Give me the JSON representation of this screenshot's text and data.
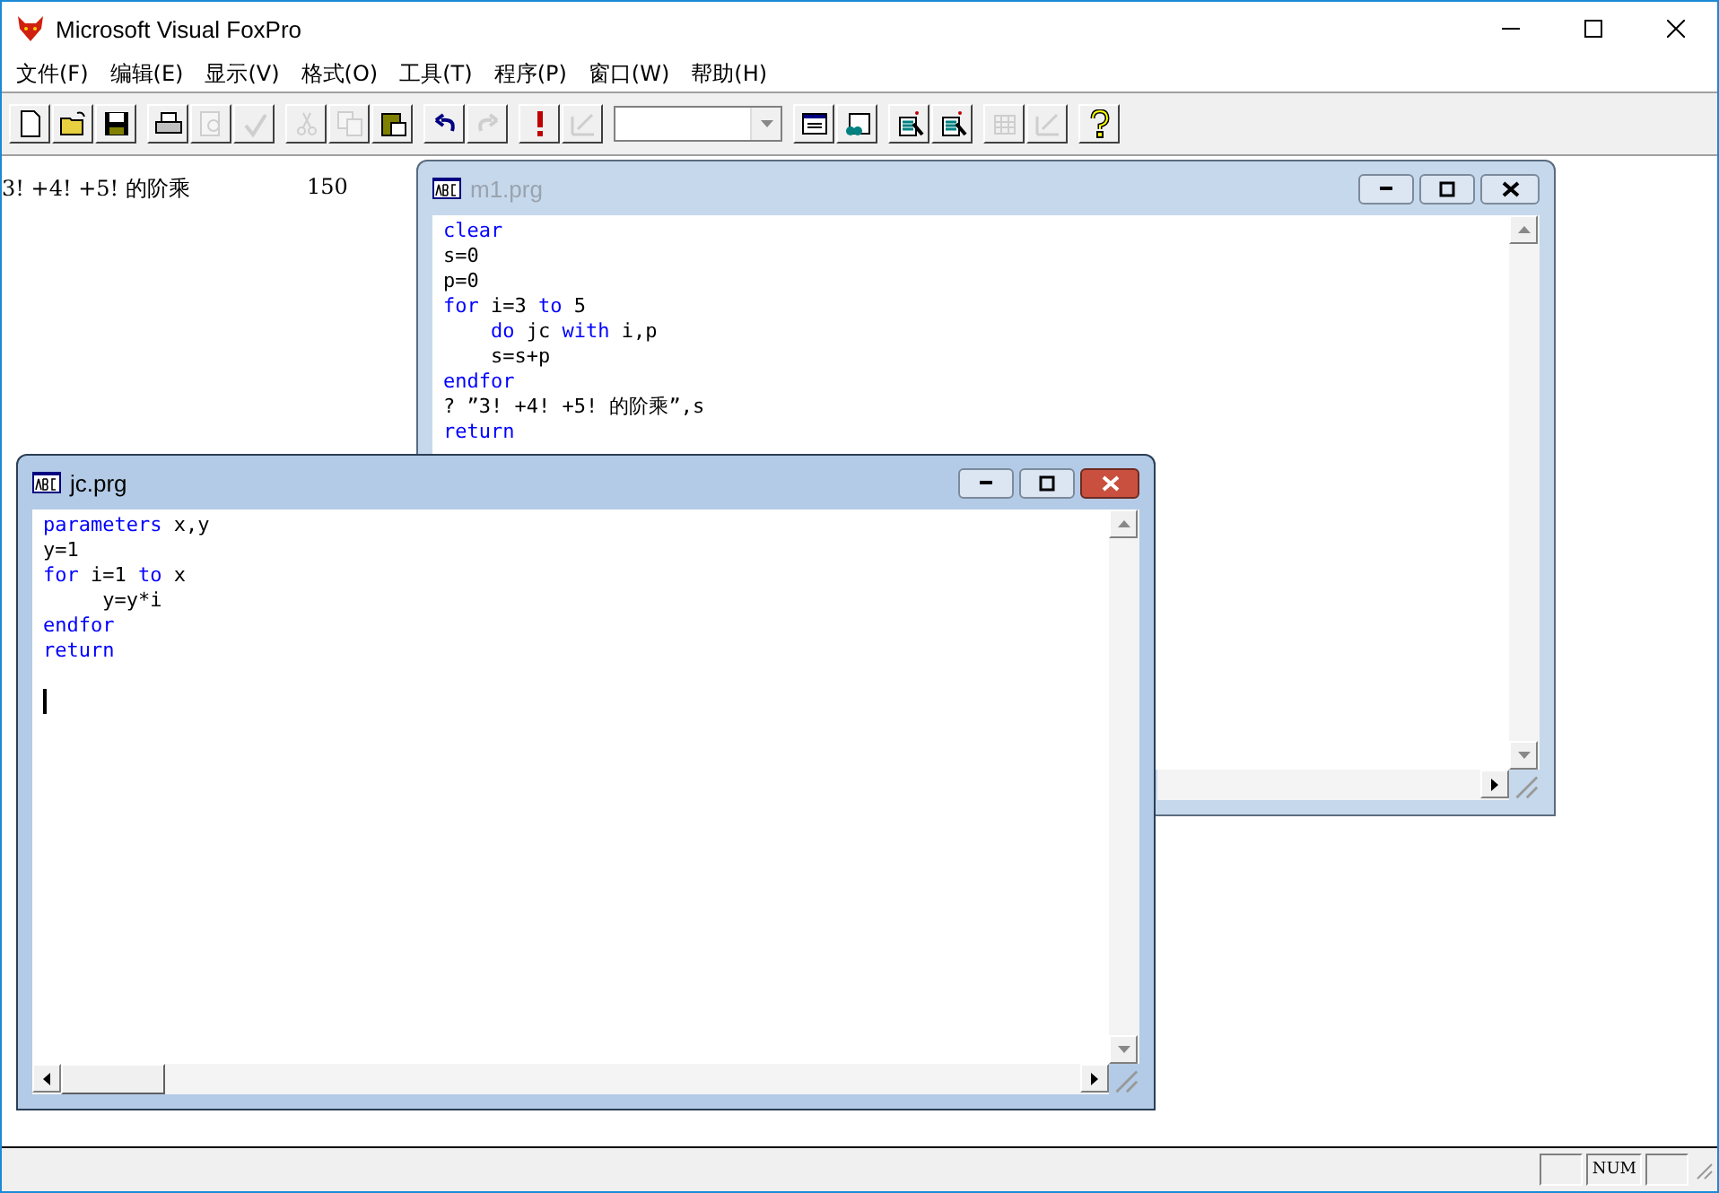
{
  "window": {
    "title": "Microsoft Visual FoxPro"
  },
  "menu": [
    {
      "label": "文件(F)"
    },
    {
      "label": "编辑(E)"
    },
    {
      "label": "显示(V)"
    },
    {
      "label": "格式(O)"
    },
    {
      "label": "工具(T)"
    },
    {
      "label": "程序(P)"
    },
    {
      "label": "窗口(W)"
    },
    {
      "label": "帮助(H)"
    }
  ],
  "toolbar": [
    [
      {
        "kind": "new",
        "disabled": false
      },
      {
        "kind": "open",
        "disabled": false
      },
      {
        "kind": "save",
        "disabled": false
      }
    ],
    [
      {
        "kind": "print",
        "disabled": false
      },
      {
        "kind": "preview",
        "disabled": true
      },
      {
        "kind": "spell",
        "disabled": true
      }
    ],
    [
      {
        "kind": "cut",
        "disabled": true
      },
      {
        "kind": "copy",
        "disabled": true
      },
      {
        "kind": "paste",
        "disabled": false
      }
    ],
    [
      {
        "kind": "undo",
        "disabled": false
      },
      {
        "kind": "redo",
        "disabled": true
      }
    ],
    [
      {
        "kind": "run",
        "disabled": false
      },
      {
        "kind": "modify",
        "disabled": true
      }
    ],
    [
      {
        "kind": "combo"
      }
    ],
    [
      {
        "kind": "form",
        "disabled": false
      },
      {
        "kind": "report",
        "disabled": false
      }
    ],
    [
      {
        "kind": "build",
        "disabled": false
      },
      {
        "kind": "build2",
        "disabled": false
      }
    ],
    [
      {
        "kind": "grid",
        "disabled": true
      },
      {
        "kind": "edit",
        "disabled": true
      }
    ],
    [
      {
        "kind": "help",
        "disabled": false
      }
    ]
  ],
  "output": [
    {
      "label": "3! +4! +5! 的阶乘",
      "value": "150"
    }
  ],
  "windows": [
    {
      "title": "m1.prg",
      "active": false,
      "lines": [
        [
          {
            "text": "clear",
            "keyword": true
          }
        ],
        [
          {
            "text": "s=0",
            "keyword": false
          }
        ],
        [
          {
            "text": "p=0",
            "keyword": false
          }
        ],
        [
          {
            "text": "for",
            "keyword": true
          },
          {
            "text": " i=3 ",
            "keyword": false
          },
          {
            "text": "to",
            "keyword": true
          },
          {
            "text": " 5",
            "keyword": false
          }
        ],
        [
          {
            "text": "    do",
            "keyword": true
          },
          {
            "text": " jc ",
            "keyword": false
          },
          {
            "text": "with",
            "keyword": true
          },
          {
            "text": " i,p",
            "keyword": false
          }
        ],
        [
          {
            "text": "    s=s+p",
            "keyword": false
          }
        ],
        [
          {
            "text": "endfor",
            "keyword": true
          }
        ],
        [
          {
            "text": "? ”3! +4! +5! 的阶乘”,s",
            "keyword": false
          }
        ],
        [
          {
            "text": "return",
            "keyword": true
          }
        ]
      ]
    },
    {
      "title": "jc.prg",
      "active": true,
      "cursor": true,
      "lines": [
        [
          {
            "text": "parameters",
            "keyword": true
          },
          {
            "text": " x,y",
            "keyword": false
          }
        ],
        [
          {
            "text": "y=1",
            "keyword": false
          }
        ],
        [
          {
            "text": "for",
            "keyword": true
          },
          {
            "text": " i=1 ",
            "keyword": false
          },
          {
            "text": "to",
            "keyword": true
          },
          {
            "text": " x",
            "keyword": false
          }
        ],
        [
          {
            "text": "     y=y*i",
            "keyword": false
          }
        ],
        [
          {
            "text": "endfor",
            "keyword": true
          }
        ],
        [
          {
            "text": "return",
            "keyword": true
          }
        ]
      ]
    }
  ],
  "status_bar": {
    "indicator": "NUM"
  }
}
